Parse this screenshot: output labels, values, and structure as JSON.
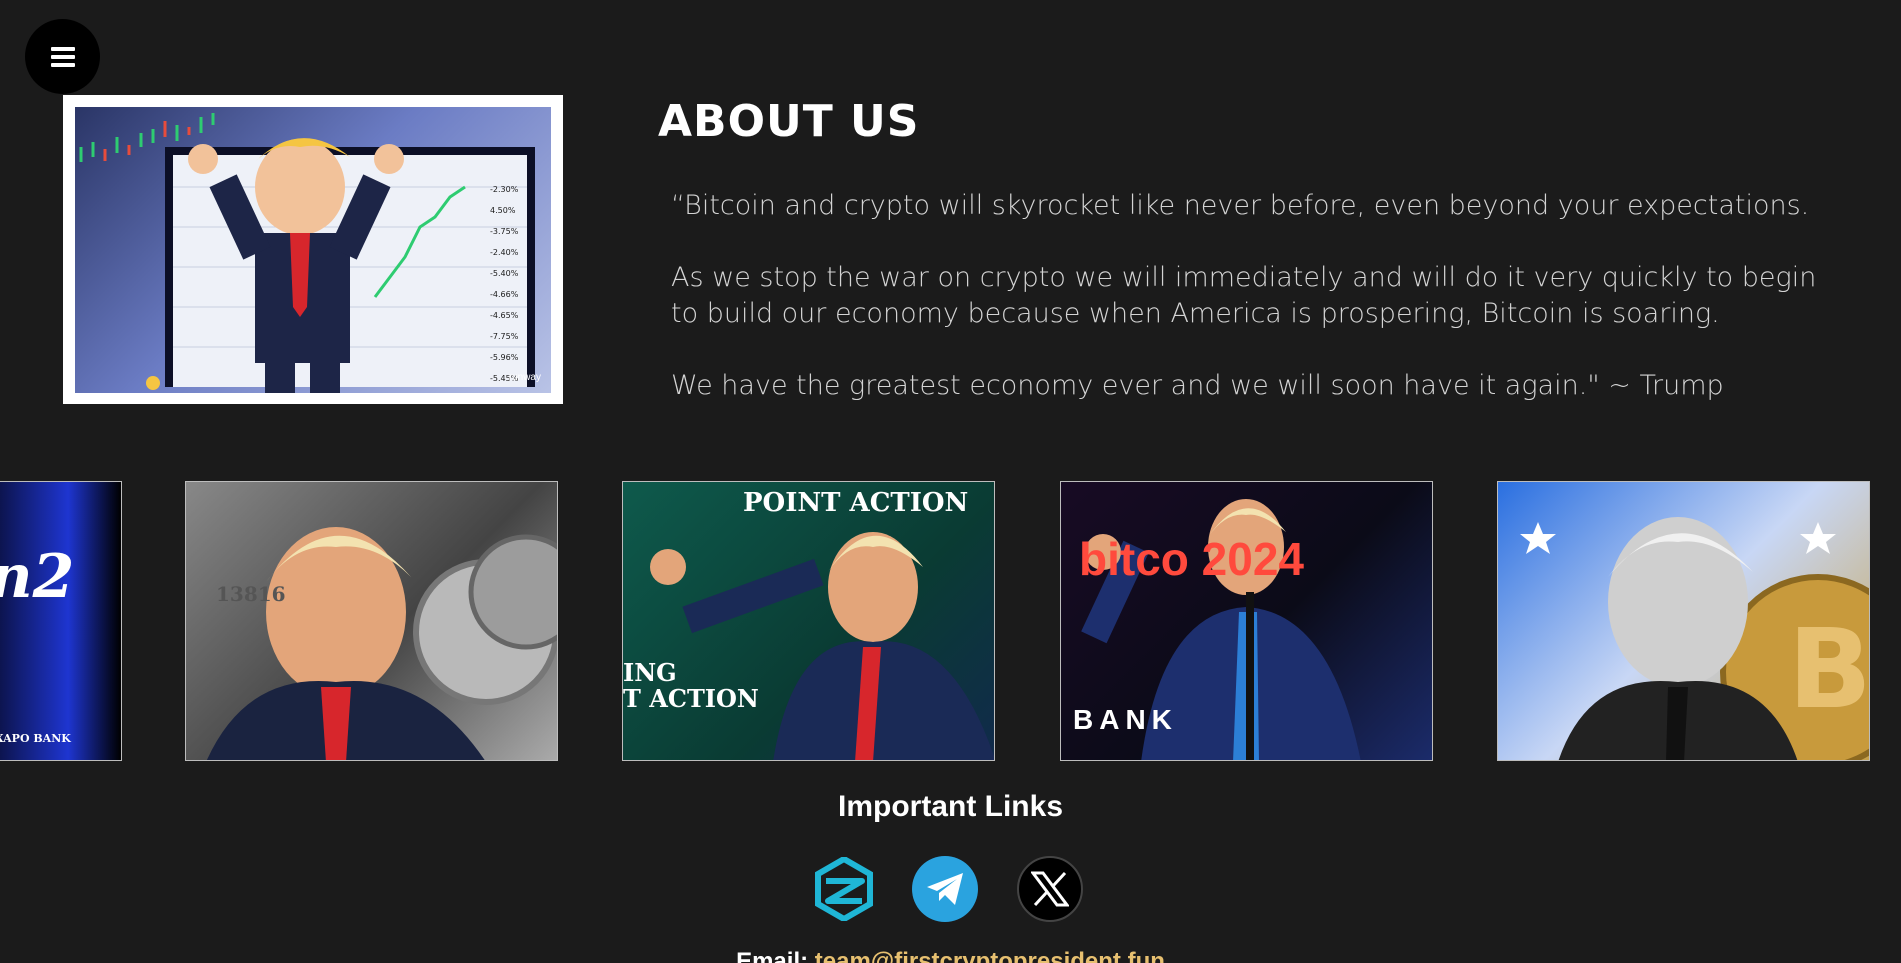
{
  "nav": {
    "menu_icon": "hamburger-menu-icon"
  },
  "about": {
    "title": "ABOUT US",
    "image_caption": "runway",
    "chart_ticks": [
      "-2.30%",
      "4.50%",
      "-3.75%",
      "-2.40%",
      "-5.40%",
      "-4.66%",
      "-4.65%",
      "-7.75%",
      "-5.96%",
      "-5.45%"
    ],
    "paragraphs": [
      "“Bitcoin and crypto will skyrocket like never before, even beyond your expectations.",
      "As we stop the war on crypto we will immediately and will do it very quickly to begin to build our economy because when America is prospering, Bitcoin is soaring.",
      "We have the greatest economy ever and we will soon have it again.\" ~ Trump"
    ]
  },
  "gallery": {
    "items": [
      {
        "overlay": "n2",
        "sub": "XAPO BANK"
      },
      {
        "overlay": "13816"
      },
      {
        "overlay": "POINT ACTION",
        "sub": "ING\nT ACTION"
      },
      {
        "overlay": "bitco 2024",
        "sub": "BANK"
      },
      {
        "overlay": ""
      }
    ]
  },
  "links": {
    "title": "Important Links",
    "icons": [
      "dexscreener-icon",
      "telegram-icon",
      "x-twitter-icon"
    ]
  },
  "contact": {
    "email_label": "Email:",
    "email": "team@firstcryptopresident.fun"
  },
  "colors": {
    "background": "#1b1b1b",
    "telegram": "#2aa3df",
    "dex": "#1fb6d6",
    "email_link": "#e7c070"
  }
}
